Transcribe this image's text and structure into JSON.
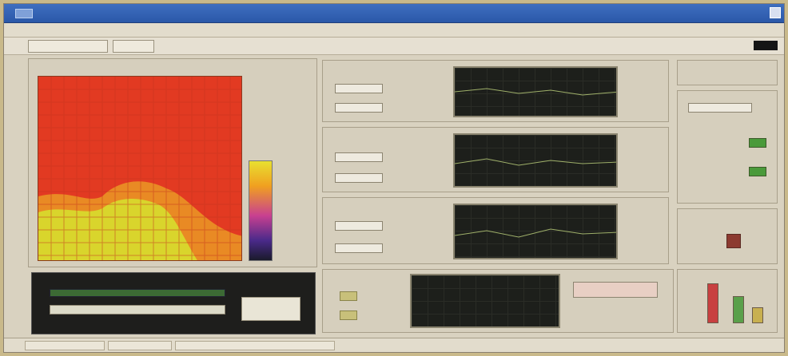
{
  "window": {
    "title": ""
  },
  "menu": [
    "",
    "",
    "",
    "",
    ""
  ],
  "toolbar": {
    "btn1": "",
    "btn2": ""
  },
  "left_panel": {
    "header": ""
  },
  "colorbar_ticks": [
    "",
    "",
    "",
    "",
    ""
  ],
  "scope_panels": [
    {
      "header": "",
      "field_a": "",
      "field_b": ""
    },
    {
      "header": "",
      "field_a": "",
      "field_b": ""
    },
    {
      "header": "",
      "field_a": "",
      "field_b": ""
    }
  ],
  "bottom_left": {
    "header": "",
    "button": ""
  },
  "status": {
    "cell1": "",
    "cell2": "",
    "cell3": ""
  },
  "colors": {
    "heat_hot": "#e03a20",
    "heat_warm": "#e87a20",
    "heat_cool": "#d8d82a",
    "scope_bg": "#1d1f1b",
    "led_on": "#4a9a3a",
    "title_blue": "#2a58a8"
  }
}
